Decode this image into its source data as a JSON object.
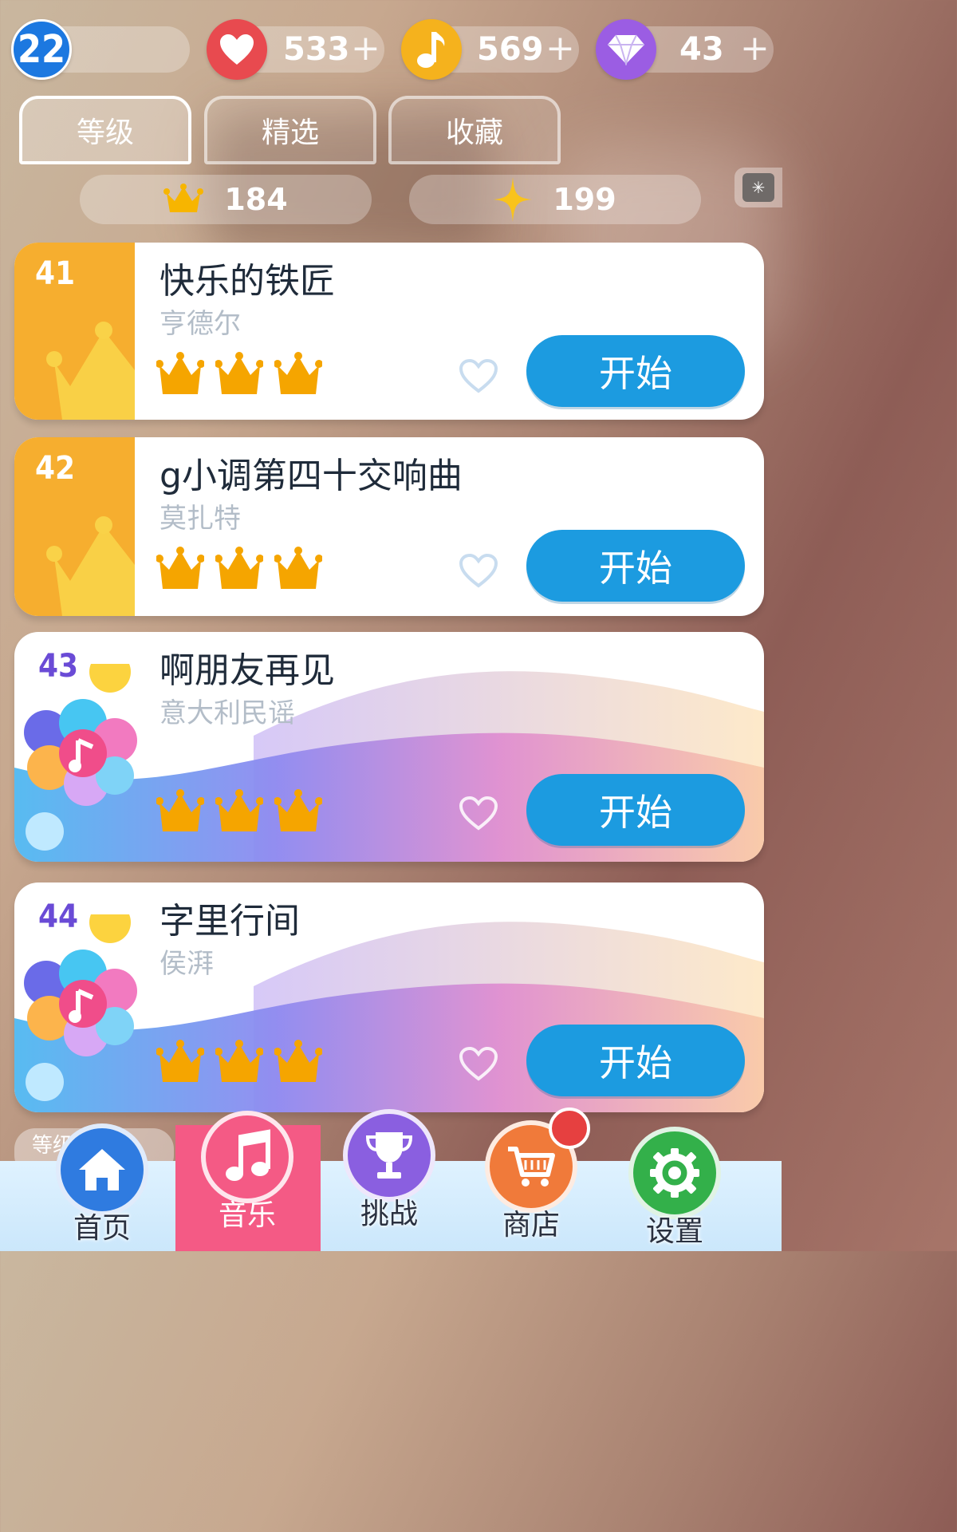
{
  "status": {
    "level": "22",
    "hearts": "533",
    "notes": "569",
    "gems": "43",
    "plus": "+"
  },
  "tabs": [
    {
      "label": "等级",
      "active": true
    },
    {
      "label": "精选",
      "active": false
    },
    {
      "label": "收藏",
      "active": false
    }
  ],
  "stats": {
    "crowns": "184",
    "stars": "199"
  },
  "songs": [
    {
      "number": "41",
      "title": "快乐的铁匠",
      "artist": "亨德尔",
      "crowns": 3,
      "style": "crown",
      "button": "开始"
    },
    {
      "number": "42",
      "title": "g小调第四十交响曲",
      "artist": "莫扎特",
      "crowns": 3,
      "style": "crown",
      "button": "开始"
    },
    {
      "number": "43",
      "title": "啊朋友再见",
      "artist": "意大利民谣",
      "crowns": 3,
      "style": "wave",
      "button": "开始"
    },
    {
      "number": "44",
      "title": "字里行间",
      "artist": "侯湃",
      "crowns": 3,
      "style": "wave",
      "button": "开始"
    }
  ],
  "partial_label": "等级",
  "nav": [
    {
      "label": "首页",
      "icon": "home-icon",
      "color": "#2f7be0"
    },
    {
      "label": "音乐",
      "icon": "music-note-icon",
      "color": "#f45a85",
      "active": true
    },
    {
      "label": "挑战",
      "icon": "trophy-icon",
      "color": "#8a5fe0"
    },
    {
      "label": "商店",
      "icon": "cart-icon",
      "color": "#f07a3a",
      "badge": true
    },
    {
      "label": "设置",
      "icon": "gear-icon",
      "color": "#33b04a"
    }
  ]
}
